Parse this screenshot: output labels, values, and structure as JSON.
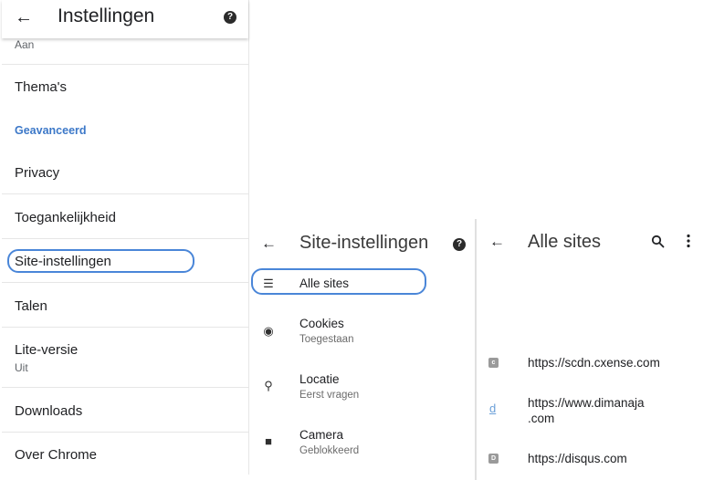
{
  "settings": {
    "title": "Instellingen",
    "partial_sub": "Aan",
    "themes": "Thema's",
    "section_advanced": "Geavanceerd",
    "privacy": "Privacy",
    "accessibility": "Toegankelijkheid",
    "site_settings": "Site-instellingen",
    "languages": "Talen",
    "lite_mode": "Lite-versie",
    "lite_mode_sub": "Uit",
    "downloads": "Downloads",
    "about": "Over Chrome"
  },
  "site_settings_panel": {
    "title": "Site-instellingen",
    "items": [
      {
        "label": "Alle sites",
        "sub": "",
        "icon": "list-icon"
      },
      {
        "label": "Cookies",
        "sub": "Toegestaan",
        "icon": "cookie-icon"
      },
      {
        "label": "Locatie",
        "sub": "Eerst vragen",
        "icon": "location-pin-icon"
      },
      {
        "label": "Camera",
        "sub": "Geblokkeerd",
        "icon": "camera-icon"
      }
    ]
  },
  "all_sites_panel": {
    "title": "Alle sites",
    "sites": [
      {
        "url": "https://scdn.cxense.com",
        "favicon_letter": "c"
      },
      {
        "url_line1": "https://www.dimanaja",
        "url_line2": ".com",
        "favicon_letter": "d"
      },
      {
        "url": "https://disqus.com",
        "favicon_letter": "D"
      }
    ]
  },
  "colors": {
    "highlight": "#4a86d8",
    "section_header": "#3c78c8"
  }
}
